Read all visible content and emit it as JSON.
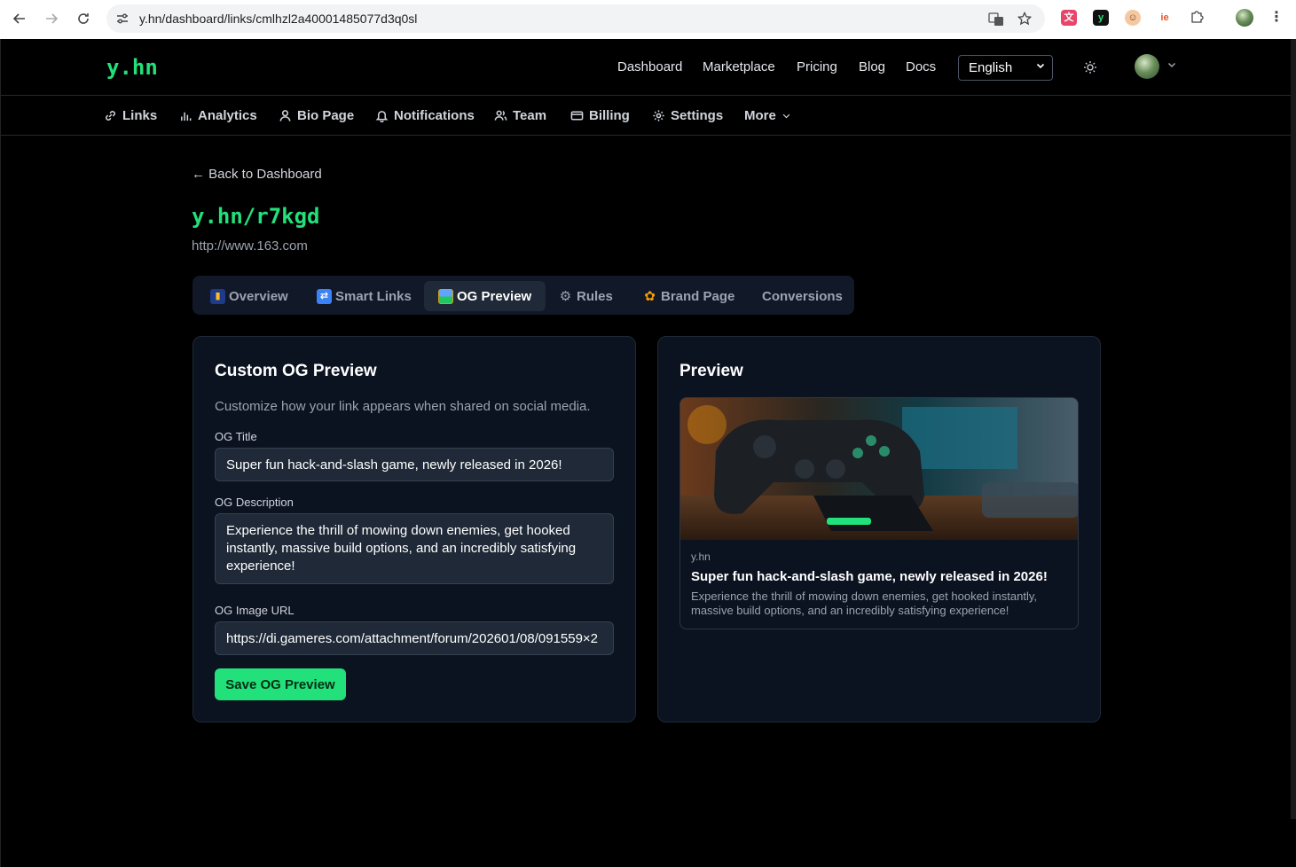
{
  "browser": {
    "url": "y.hn/dashboard/links/cmlhzl2a40001485077d3q0sl"
  },
  "header": {
    "logo": "y.hn",
    "nav": [
      "Dashboard",
      "Marketplace",
      "Pricing",
      "Blog",
      "Docs"
    ],
    "language": "English"
  },
  "subnav": {
    "items": [
      {
        "label": "Links",
        "icon": "link-icon"
      },
      {
        "label": "Analytics",
        "icon": "bar-chart-icon"
      },
      {
        "label": "Bio Page",
        "icon": "user-icon"
      },
      {
        "label": "Notifications",
        "icon": "bell-icon"
      },
      {
        "label": "Team",
        "icon": "users-icon"
      },
      {
        "label": "Billing",
        "icon": "credit-card-icon"
      },
      {
        "label": "Settings",
        "icon": "gear-icon"
      },
      {
        "label": "More",
        "icon": "chevron-down-icon"
      }
    ]
  },
  "page": {
    "back_label": "← Back to Dashboard",
    "short_link": "y.hn/r7kgd",
    "original_url": "http://www.163.com"
  },
  "tabs": [
    {
      "label": "Overview",
      "emoji": "📊",
      "active": false
    },
    {
      "label": "Smart Links",
      "emoji": "🔀",
      "active": false
    },
    {
      "label": "OG Preview",
      "emoji": "🖼️",
      "active": true
    },
    {
      "label": "Rules",
      "emoji": "⚙️",
      "active": false
    },
    {
      "label": "Brand Page",
      "emoji": "🎨",
      "active": false
    },
    {
      "label": "Conversions",
      "emoji": "",
      "active": false
    }
  ],
  "custom_og": {
    "title": "Custom OG Preview",
    "subtitle": "Customize how your link appears when shared on social media.",
    "og_title_label": "OG Title",
    "og_title_value": "Super fun hack-and-slash game, newly released in 2026!",
    "og_description_label": "OG Description",
    "og_description_value": "Experience the thrill of mowing down enemies, get hooked instantly, massive build options, and an incredibly satisfying experience!",
    "og_image_label": "OG Image URL",
    "og_image_value": "https://di.gameres.com/attachment/forum/202601/08/091559×2",
    "save_label": "Save OG Preview"
  },
  "preview": {
    "title": "Preview",
    "domain": "y.hn",
    "og_title": "Super fun hack-and-slash game, newly released in 2026!",
    "og_description": "Experience the thrill of mowing down enemies, get hooked instantly, massive build options, and an incredibly satisfying experience!"
  },
  "colors": {
    "accent": "#22e07a",
    "background": "#000000",
    "card": "#0b1220"
  }
}
